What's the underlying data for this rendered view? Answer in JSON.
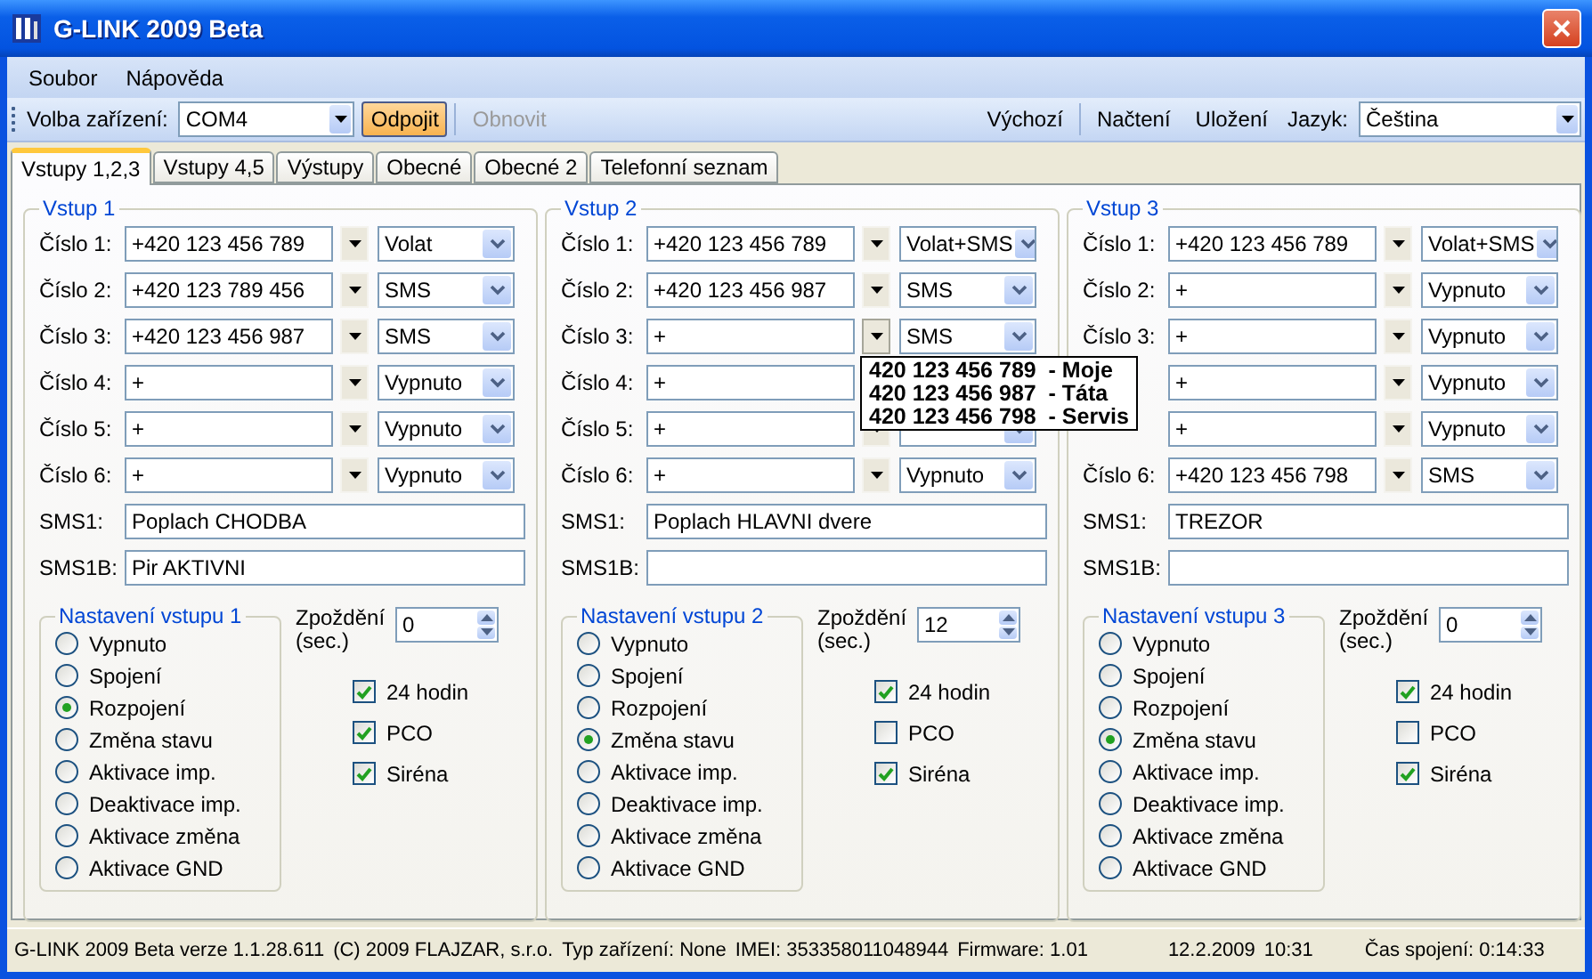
{
  "window": {
    "title": "G-LINK 2009 Beta"
  },
  "menu": [
    "Soubor",
    "Nápověda"
  ],
  "toolbar": {
    "device_label": "Volba zařízení:",
    "device": "COM4",
    "connect_button": "Odpojit",
    "refresh_button": "Obnovit",
    "refresh_disabled": true,
    "right_buttons": [
      "Výchozí",
      "Načtení",
      "Uložení"
    ],
    "language_label": "Jazyk:",
    "language": "Čeština"
  },
  "tabs": [
    {
      "label": "Vstupy 1,2,3",
      "selected": true
    },
    {
      "label": "Vstupy 4,5",
      "selected": false
    },
    {
      "label": "Výstupy",
      "selected": false
    },
    {
      "label": "Obecné",
      "selected": false
    },
    {
      "label": "Obecné 2",
      "selected": false
    },
    {
      "label": "Telefonní seznam",
      "selected": false
    }
  ],
  "inputs": [
    {
      "title": "Vstup 1",
      "numbers": [
        {
          "label": "Číslo 1:",
          "number": "+420 123 456 789",
          "mode": "Volat"
        },
        {
          "label": "Číslo 2:",
          "number": "+420 123 789 456",
          "mode": "SMS"
        },
        {
          "label": "Číslo 3:",
          "number": "+420 123 456 987",
          "mode": "SMS"
        },
        {
          "label": "Číslo 4:",
          "number": "+",
          "mode": "Vypnuto"
        },
        {
          "label": "Číslo 5:",
          "number": "+",
          "mode": "Vypnuto"
        },
        {
          "label": "Číslo 6:",
          "number": "+",
          "mode": "Vypnuto"
        }
      ],
      "sms": [
        {
          "label": "SMS1:",
          "value": "Poplach CHODBA"
        },
        {
          "label": "SMS1B:",
          "value": "Pir AKTIVNI"
        }
      ],
      "settings": {
        "title": "Nastavení vstupu 1",
        "options": [
          {
            "label": "Vypnuto",
            "selected": false
          },
          {
            "label": "Spojení",
            "selected": false
          },
          {
            "label": "Rozpojení",
            "selected": true
          },
          {
            "label": "Změna stavu",
            "selected": false
          },
          {
            "label": "Aktivace imp.",
            "selected": false
          },
          {
            "label": "Deaktivace imp.",
            "selected": false
          },
          {
            "label": "Aktivace změna",
            "selected": false
          },
          {
            "label": "Aktivace GND",
            "selected": false
          }
        ],
        "delay_label": "Zpoždění (sec.)",
        "delay": "0",
        "flags": [
          {
            "label": "24 hodin",
            "checked": true
          },
          {
            "label": "PCO",
            "checked": true
          },
          {
            "label": "Siréna",
            "checked": true
          }
        ]
      }
    },
    {
      "title": "Vstup 2",
      "numbers": [
        {
          "label": "Číslo 1:",
          "number": "+420 123 456 789",
          "mode": "Volat+SMS"
        },
        {
          "label": "Číslo 2:",
          "number": "+420 123 456 987",
          "mode": "SMS"
        },
        {
          "label": "Číslo 3:",
          "number": "+",
          "mode": "SMS",
          "phonebook": [
            "420 123 456 789  - Moje",
            "420 123 456 987  - Táta",
            "420 123 456 798  - Servis"
          ]
        },
        {
          "label": "Číslo 4:",
          "number": "+"
        },
        {
          "label": "Číslo 5:",
          "number": "+"
        },
        {
          "label": "Číslo 6:",
          "number": "+",
          "mode": "Vypnuto"
        }
      ],
      "sms": [
        {
          "label": "SMS1:",
          "value": "Poplach HLAVNI dvere"
        },
        {
          "label": "SMS1B:"
        }
      ],
      "settings": {
        "title": "Nastavení vstupu 2",
        "options": [
          {
            "label": "Vypnuto",
            "selected": false
          },
          {
            "label": "Spojení",
            "selected": false
          },
          {
            "label": "Rozpojení",
            "selected": false
          },
          {
            "label": "Změna stavu",
            "selected": true
          },
          {
            "label": "Aktivace imp.",
            "selected": false
          },
          {
            "label": "Deaktivace imp.",
            "selected": false
          },
          {
            "label": "Aktivace změna",
            "selected": false
          },
          {
            "label": "Aktivace GND",
            "selected": false
          }
        ],
        "delay_label": "Zpoždění (sec.)",
        "delay": "12",
        "flags": [
          {
            "label": "24 hodin",
            "checked": true
          },
          {
            "label": "PCO",
            "checked": false
          },
          {
            "label": "Siréna",
            "checked": true
          }
        ]
      }
    },
    {
      "title": "Vstup 3",
      "numbers": [
        {
          "label": "Číslo 1:",
          "number": "+420 123 456 789",
          "mode": "Volat+SMS"
        },
        {
          "label": "Číslo 2:",
          "number": "+",
          "mode": "Vypnuto"
        },
        {
          "label": "Číslo 3:",
          "number": "+",
          "mode": "Vypnuto"
        },
        {
          "number": "+",
          "mode": "Vypnuto"
        },
        {
          "number": "+",
          "mode": "Vypnuto"
        },
        {
          "label": "Číslo 6:",
          "number": "+420 123 456 798",
          "mode": "SMS"
        }
      ],
      "sms": [
        {
          "label": "SMS1:",
          "value": "TREZOR"
        },
        {
          "label": "SMS1B:"
        }
      ],
      "settings": {
        "title": "Nastavení vstupu 3",
        "options": [
          {
            "label": "Vypnuto",
            "selected": false
          },
          {
            "label": "Spojení",
            "selected": false
          },
          {
            "label": "Rozpojení",
            "selected": false
          },
          {
            "label": "Změna stavu",
            "selected": true
          },
          {
            "label": "Aktivace imp.",
            "selected": false
          },
          {
            "label": "Deaktivace imp.",
            "selected": false
          },
          {
            "label": "Aktivace změna",
            "selected": false
          },
          {
            "label": "Aktivace GND",
            "selected": false
          }
        ],
        "delay_label": "Zpoždění (sec.)",
        "delay": "0",
        "flags": [
          {
            "label": "24 hodin",
            "checked": true
          },
          {
            "label": "PCO",
            "checked": false
          },
          {
            "label": "Siréna",
            "checked": true
          }
        ]
      }
    }
  ],
  "status_bar": [
    "G-LINK 2009 Beta verze 1.1.28.611",
    "(C) 2009 FLAJZAR, s.r.o.",
    "Typ zařízení: None",
    "IMEI: 353358011048944",
    "Firmware: 1.01",
    "12.2.2009",
    "10:31",
    "Čas spojení: 0:14:33"
  ]
}
